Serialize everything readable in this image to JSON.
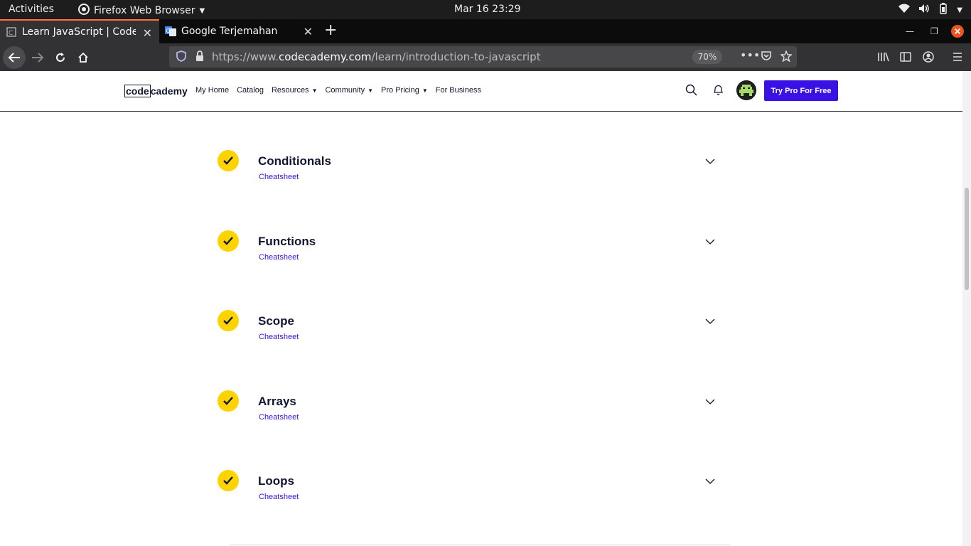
{
  "system": {
    "activities": "Activities",
    "app_name": "Firefox Web Browser",
    "clock": "Mar 16  23:29"
  },
  "browser": {
    "tabs": [
      {
        "title": "Learn JavaScript | Codecademy",
        "active": true
      },
      {
        "title": "Google Terjemahan",
        "active": false
      }
    ],
    "url_prefix": "https://www.",
    "url_domain": "codecademy.com",
    "url_path": "/learn/introduction-to-javascript",
    "zoom": "70%"
  },
  "site": {
    "logo_code": "code",
    "logo_academy": "cademy",
    "nav": [
      {
        "label": "My Home",
        "dropdown": false
      },
      {
        "label": "Catalog",
        "dropdown": false
      },
      {
        "label": "Resources",
        "dropdown": true
      },
      {
        "label": "Community",
        "dropdown": true
      },
      {
        "label": "Pro Pricing",
        "dropdown": true
      },
      {
        "label": "For Business",
        "dropdown": false
      }
    ],
    "cta": "Try Pro For Free",
    "accent": "#3a10e5",
    "check_color": "#ffd300"
  },
  "modules": [
    {
      "title": "Conditionals",
      "link": "Cheatsheet",
      "completed": true
    },
    {
      "title": "Functions",
      "link": "Cheatsheet",
      "completed": true
    },
    {
      "title": "Scope",
      "link": "Cheatsheet",
      "completed": true
    },
    {
      "title": "Arrays",
      "link": "Cheatsheet",
      "completed": true
    },
    {
      "title": "Loops",
      "link": "Cheatsheet",
      "completed": true
    }
  ]
}
